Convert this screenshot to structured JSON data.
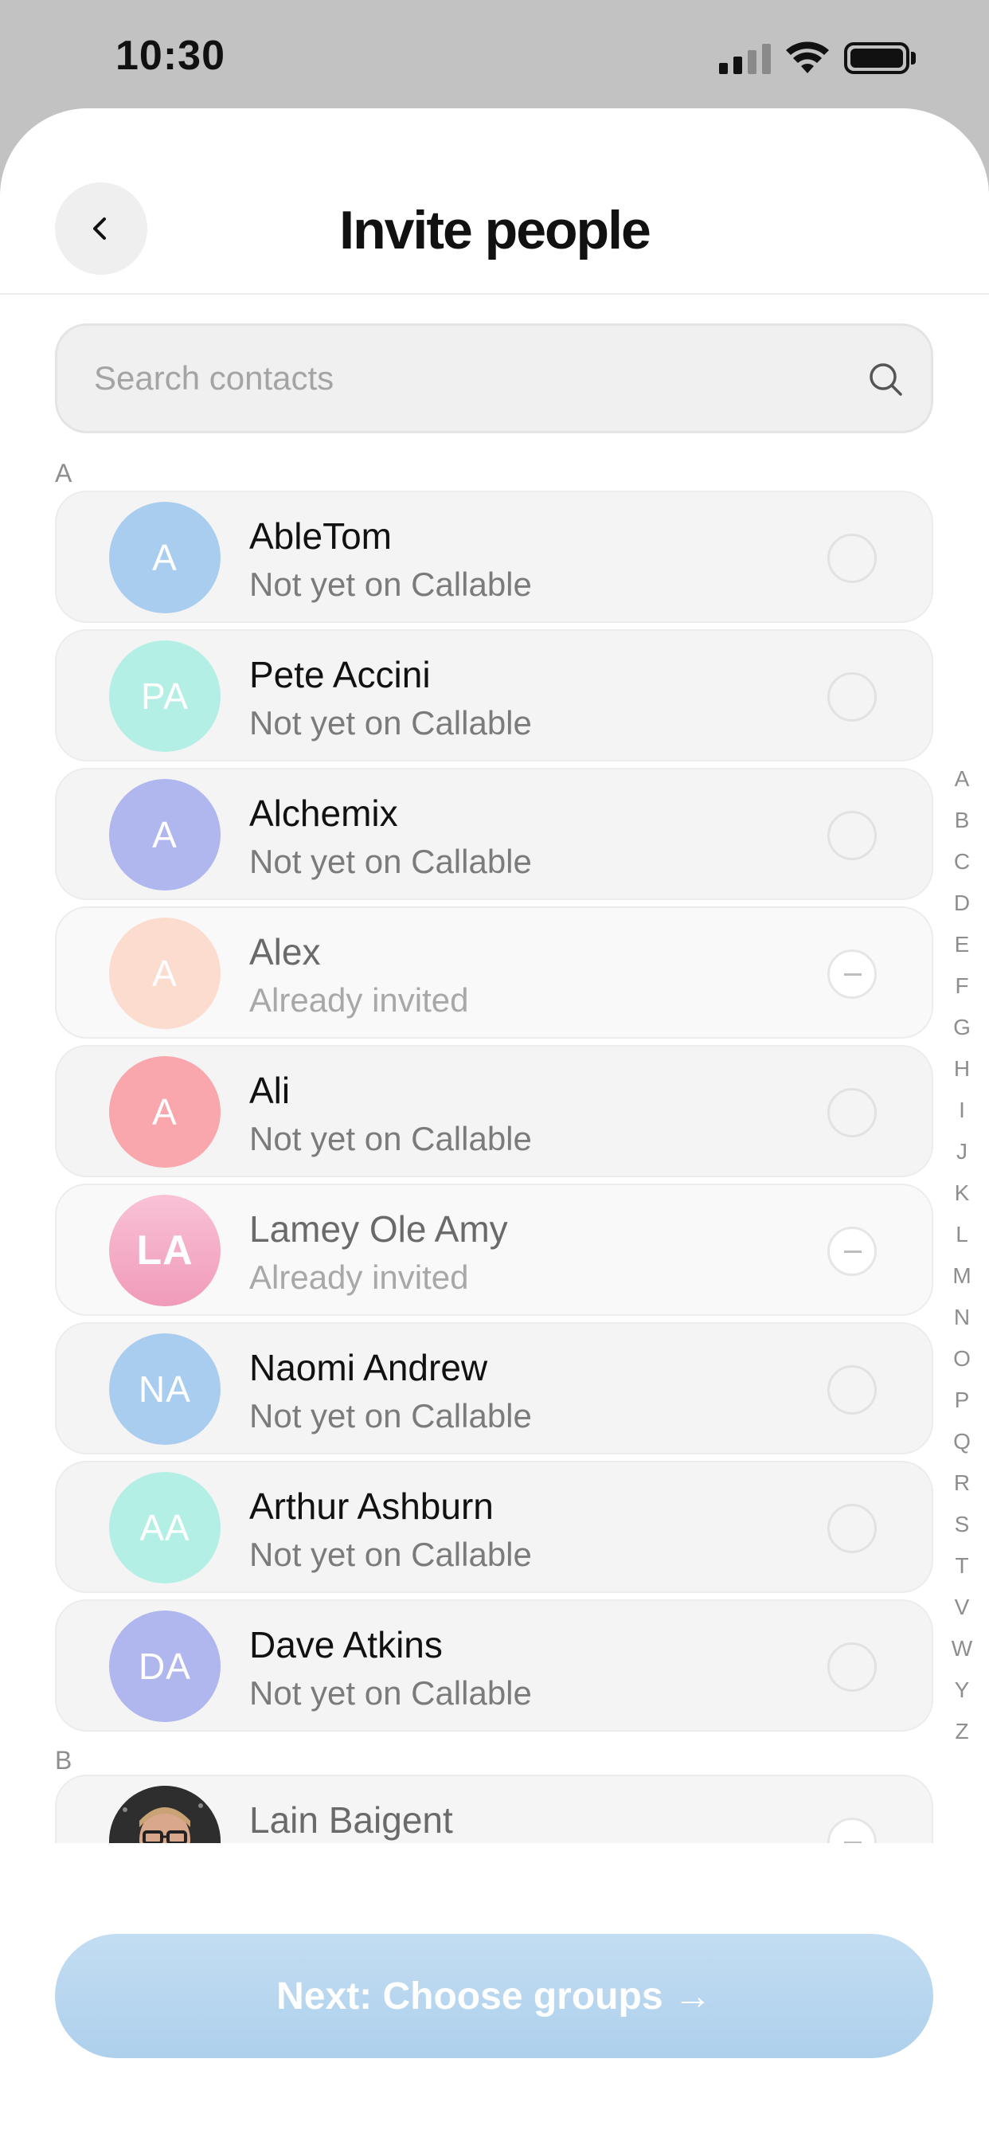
{
  "status_bar": {
    "time": "10:30"
  },
  "header": {
    "title": "Invite people"
  },
  "search": {
    "placeholder": "Search contacts",
    "value": ""
  },
  "sections": [
    {
      "letter": "A",
      "contacts": [
        {
          "initials": "A",
          "name": "AbleTom",
          "status": "Not yet on Callable",
          "color": "#a9cdef",
          "invited": false
        },
        {
          "initials": "PA",
          "name": "Pete Accini",
          "status": "Not yet on Callable",
          "color": "#b4efe6",
          "invited": false
        },
        {
          "initials": "A",
          "name": "Alchemix",
          "status": "Not yet on Callable",
          "color": "#b0b6ee",
          "invited": false
        },
        {
          "initials": "A",
          "name": "Alex",
          "status": "Already invited",
          "color": "#fbdcce",
          "invited": true
        },
        {
          "initials": "A",
          "name": "Ali",
          "status": "Not yet on Callable",
          "color": "#f9a6ac",
          "invited": false
        },
        {
          "initials": "LA",
          "name": "Lamey Ole Amy",
          "status": "Already invited",
          "color": "#f5b2cb",
          "invited": true
        },
        {
          "initials": "NA",
          "name": "Naomi Andrew",
          "status": "Not yet on Callable",
          "color": "#a9cdef",
          "invited": false
        },
        {
          "initials": "AA",
          "name": "Arthur Ashburn",
          "status": "Not yet on Callable",
          "color": "#b4efe6",
          "invited": false
        },
        {
          "initials": "DA",
          "name": "Dave Atkins",
          "status": "Not yet on Callable",
          "color": "#b0b6ee",
          "invited": false
        }
      ]
    },
    {
      "letter": "B",
      "contacts": [
        {
          "initials": "",
          "name": "Lain Baigent",
          "status": "",
          "color": "#3b3b3b",
          "invited": true,
          "photo": true
        }
      ]
    }
  ],
  "alpha_index": [
    "A",
    "B",
    "C",
    "D",
    "E",
    "F",
    "G",
    "H",
    "I",
    "J",
    "K",
    "L",
    "M",
    "N",
    "O",
    "P",
    "Q",
    "R",
    "S",
    "T",
    "V",
    "W",
    "Y",
    "Z"
  ],
  "next_button": {
    "label": "Next: Choose groups →"
  },
  "colors": {
    "accent": "#aed0ec",
    "background": "#ffffff",
    "status_bar": "#c2c2c2"
  }
}
